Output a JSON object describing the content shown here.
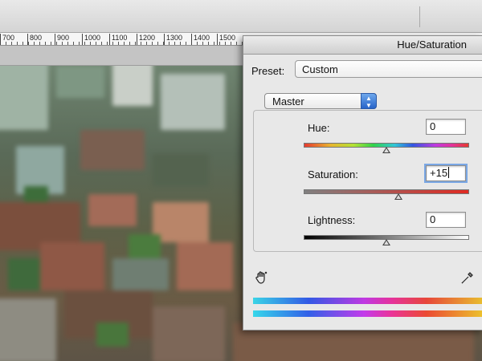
{
  "ruler": {
    "labels": [
      "700",
      "800",
      "900",
      "1000",
      "1100",
      "1200",
      "1300",
      "1400",
      "1500"
    ]
  },
  "dialog": {
    "title": "Hue/Saturation",
    "preset_label": "Preset:",
    "preset_value": "Custom",
    "channel_value": "Master",
    "hue": {
      "label": "Hue:",
      "value": "0",
      "level": 0
    },
    "saturation": {
      "label": "Saturation:",
      "value": "+15",
      "level": 15
    },
    "lightness": {
      "label": "Lightness:",
      "value": "0",
      "level": 0
    },
    "icons": {
      "adjust_tool": "hand-adjust-icon",
      "eyedropper": "eyedropper-icon"
    }
  },
  "colors": {
    "dialog_bg": "#e8e8e8",
    "stepper_blue": "#2764c9"
  }
}
